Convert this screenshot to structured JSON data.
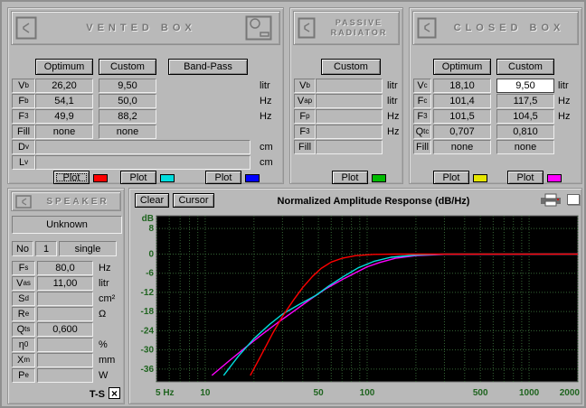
{
  "vented_box": {
    "title": "VENTED BOX",
    "buttons": {
      "optimum": "Optimum",
      "custom": "Custom",
      "bandpass": "Band-Pass"
    },
    "rows": [
      {
        "label": "V",
        "sub": "b",
        "optimum": "26,20",
        "custom": "9,50",
        "unit": "litr"
      },
      {
        "label": "F",
        "sub": "b",
        "optimum": "54,1",
        "custom": "50,0",
        "unit": "Hz"
      },
      {
        "label": "F",
        "sub": "3",
        "optimum": "49,9",
        "custom": "88,2",
        "unit": "Hz"
      },
      {
        "label": "Fill",
        "sub": "",
        "optimum": "none",
        "custom": "none",
        "unit": ""
      }
    ],
    "wide_rows": [
      {
        "label": "D",
        "sub": "v",
        "value": "",
        "unit": "cm"
      },
      {
        "label": "L",
        "sub": "v",
        "value": "",
        "unit": "cm"
      }
    ],
    "plot_label": "Plot",
    "plot_colors": [
      "#ff0000",
      "#00dddd",
      "#0000ff"
    ]
  },
  "passive_radiator": {
    "title_line1": "PASSIVE",
    "title_line2": "RADIATOR",
    "button": "Custom",
    "rows": [
      {
        "label": "V",
        "sub": "b",
        "value": "",
        "unit": "litr"
      },
      {
        "label": "V",
        "sub": "ap",
        "value": "",
        "unit": "litr"
      },
      {
        "label": "F",
        "sub": "p",
        "value": "",
        "unit": "Hz"
      },
      {
        "label": "F",
        "sub": "3",
        "value": "",
        "unit": "Hz"
      },
      {
        "label": "Fill",
        "sub": "",
        "value": "",
        "unit": ""
      }
    ],
    "plot_label": "Plot",
    "plot_color": "#00bb00"
  },
  "closed_box": {
    "title": "CLOSED BOX",
    "buttons": {
      "optimum": "Optimum",
      "custom": "Custom"
    },
    "rows": [
      {
        "label": "V",
        "sub": "c",
        "optimum": "18,10",
        "custom": "9,50",
        "unit": "litr"
      },
      {
        "label": "F",
        "sub": "c",
        "optimum": "101,4",
        "custom": "117,5",
        "unit": "Hz"
      },
      {
        "label": "F",
        "sub": "3",
        "optimum": "101,5",
        "custom": "104,5",
        "unit": "Hz"
      },
      {
        "label": "Q",
        "sub": "tc",
        "optimum": "0,707",
        "custom": "0,810",
        "unit": ""
      },
      {
        "label": "Fill",
        "sub": "",
        "optimum": "none",
        "custom": "none",
        "unit": ""
      }
    ],
    "plot_label": "Plot",
    "plot_colors": [
      "#e6e600",
      "#ff00ff"
    ]
  },
  "speaker": {
    "title": "SPEAKER",
    "name": "Unknown",
    "no_label": "No",
    "no_value": "1",
    "type_value": "single",
    "rows": [
      {
        "label": "F",
        "sub": "s",
        "value": "80,0",
        "unit": "Hz"
      },
      {
        "label": "V",
        "sub": "as",
        "value": "11,00",
        "unit": "litr"
      },
      {
        "label": "S",
        "sub": "d",
        "value": "",
        "unit": "cm²"
      },
      {
        "label": "R",
        "sub": "e",
        "value": "",
        "unit": "Ω"
      },
      {
        "label": "Q",
        "sub": "ts",
        "value": "0,600",
        "unit": ""
      },
      {
        "label": "η",
        "sub": "0",
        "value": "",
        "unit": "%"
      },
      {
        "label": "X",
        "sub": "m",
        "value": "",
        "unit": "mm"
      },
      {
        "label": "P",
        "sub": "e",
        "value": "",
        "unit": "W"
      }
    ],
    "ts_label": "T-S",
    "ts_checked": "×"
  },
  "chart": {
    "clear_button": "Clear",
    "cursor_button": "Cursor",
    "title": "Normalized Amplitude Response (dB/Hz)"
  },
  "chart_data": {
    "type": "line",
    "title": "Normalized Amplitude Response (dB/Hz)",
    "x_scale": "log",
    "x_range": [
      5,
      2000
    ],
    "y_range": [
      -40,
      12
    ],
    "y_axis_label": "dB",
    "y_ticks": [
      8,
      0,
      -6,
      -12,
      -18,
      -24,
      -30,
      -36
    ],
    "x_tick_labels": [
      {
        "f": 5,
        "text": "5 Hz"
      },
      {
        "f": 10,
        "text": "10"
      },
      {
        "f": 50,
        "text": "50"
      },
      {
        "f": 100,
        "text": "100"
      },
      {
        "f": 500,
        "text": "500"
      },
      {
        "f": 1000,
        "text": "1000"
      },
      {
        "f": 2000,
        "text": "2000"
      }
    ],
    "x_gridlines": [
      5,
      6,
      7,
      8,
      9,
      10,
      20,
      30,
      40,
      50,
      60,
      70,
      80,
      90,
      100,
      200,
      300,
      400,
      500,
      600,
      700,
      800,
      900,
      1000,
      2000
    ],
    "grid_color": "#356535",
    "axis_text_color": "#1f641f",
    "background": "#000000",
    "legend": "off",
    "series": [
      {
        "name": "closed-box-custom",
        "color": "#ff00ff",
        "points": [
          [
            11,
            -38
          ],
          [
            14,
            -33.5
          ],
          [
            18,
            -29
          ],
          [
            22,
            -25.5
          ],
          [
            28,
            -21.5
          ],
          [
            35,
            -18
          ],
          [
            45,
            -14
          ],
          [
            55,
            -11
          ],
          [
            70,
            -8
          ],
          [
            85,
            -5.8
          ],
          [
            100,
            -4
          ],
          [
            120,
            -2.6
          ],
          [
            150,
            -1.3
          ],
          [
            200,
            -0.5
          ],
          [
            300,
            -0.1
          ],
          [
            2000,
            0
          ]
        ]
      },
      {
        "name": "vented-box-custom",
        "color": "#00dddd",
        "points": [
          [
            13,
            -38
          ],
          [
            16,
            -32
          ],
          [
            20,
            -26.5
          ],
          [
            25,
            -22
          ],
          [
            30,
            -18.8
          ],
          [
            38,
            -15.8
          ],
          [
            48,
            -13
          ],
          [
            58,
            -10
          ],
          [
            70,
            -7.3
          ],
          [
            88,
            -4.3
          ],
          [
            110,
            -2.3
          ],
          [
            140,
            -1
          ],
          [
            200,
            -0.3
          ],
          [
            300,
            0
          ],
          [
            2000,
            0
          ]
        ]
      },
      {
        "name": "vented-box-optimum",
        "color": "#ff0000",
        "points": [
          [
            19,
            -38
          ],
          [
            22,
            -32
          ],
          [
            26,
            -25
          ],
          [
            30,
            -19.5
          ],
          [
            35,
            -14.5
          ],
          [
            40,
            -10.5
          ],
          [
            46,
            -7
          ],
          [
            52,
            -4.5
          ],
          [
            60,
            -2.5
          ],
          [
            70,
            -1.3
          ],
          [
            85,
            -0.5
          ],
          [
            110,
            -0.1
          ],
          [
            150,
            0
          ],
          [
            2000,
            0
          ]
        ]
      }
    ]
  }
}
